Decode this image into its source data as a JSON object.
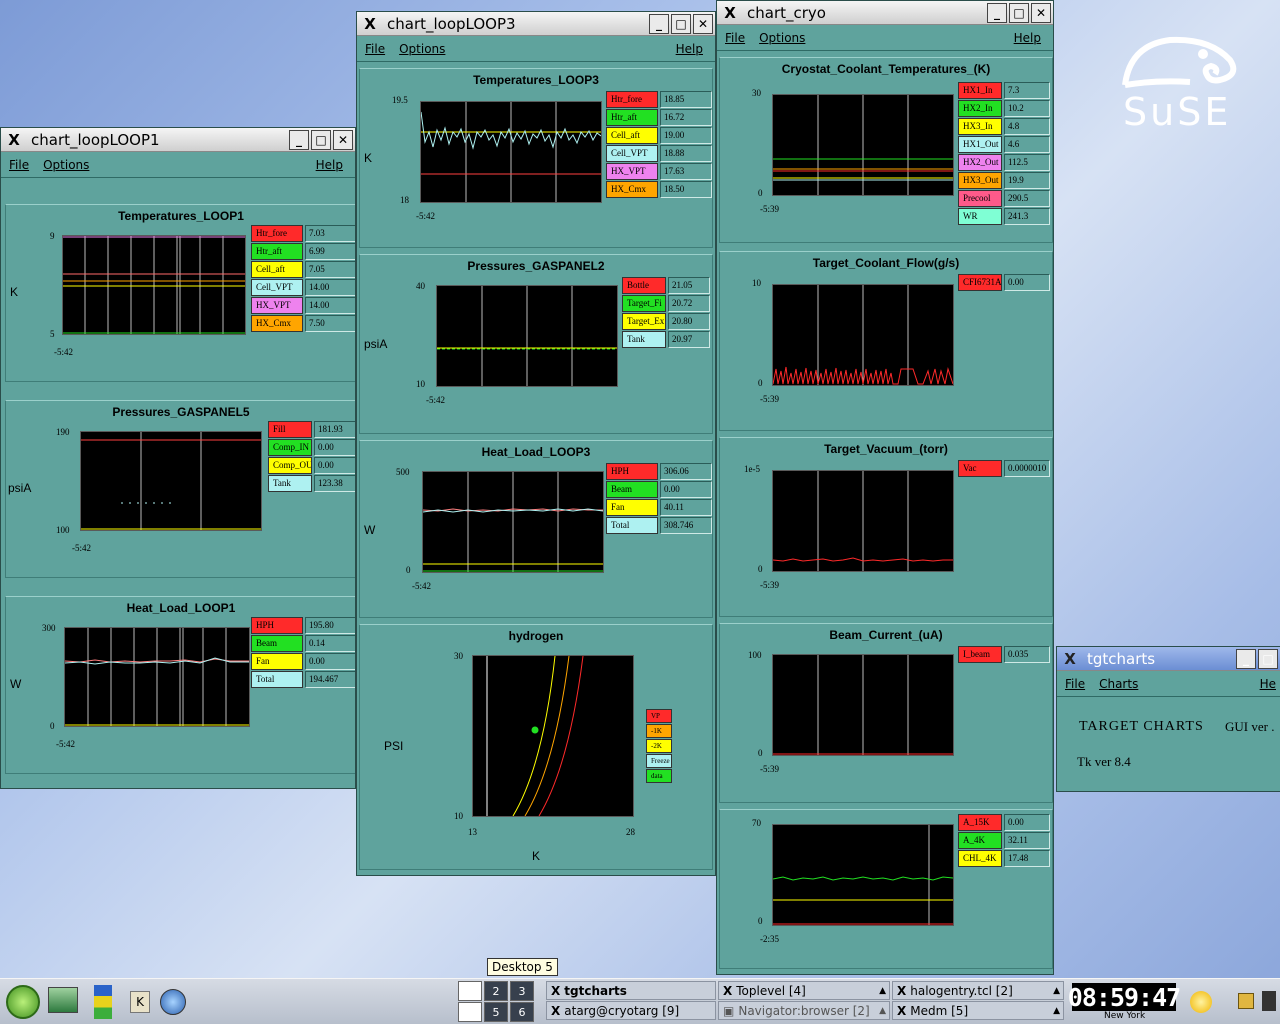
{
  "desktop": {
    "logo_text": "SuSE"
  },
  "loop1": {
    "title": "chart_loopLOOP1",
    "menu": {
      "file": "File",
      "options": "Options",
      "help": "Help"
    },
    "temps": {
      "title": "Temperatures_LOOP1",
      "unit": "K",
      "ymax": "9",
      "ymin": "5",
      "xmin": "-5:42",
      "legend": [
        {
          "name": "Htr_fore",
          "value": "7.03",
          "color": "#ff2a2a"
        },
        {
          "name": "Htr_aft",
          "value": "6.99",
          "color": "#22e022"
        },
        {
          "name": "Cell_aft",
          "value": "7.05",
          "color": "#ffff00"
        },
        {
          "name": "Cell_VPT",
          "value": "14.00",
          "color": "#aef1f1"
        },
        {
          "name": "HX_VPT",
          "value": "14.00",
          "color": "#ee82ee"
        },
        {
          "name": "HX_Cmx",
          "value": "7.50",
          "color": "#ffa500"
        }
      ]
    },
    "press": {
      "title": "Pressures_GASPANEL5",
      "unit": "psiA",
      "ymax": "190",
      "ymin": "100",
      "xmin": "-5:42",
      "legend": [
        {
          "name": "Fill",
          "value": "181.93",
          "color": "#ff2a2a"
        },
        {
          "name": "Comp_IN",
          "value": "0.00",
          "color": "#22e022"
        },
        {
          "name": "Comp_OUT",
          "value": "0.00",
          "color": "#ffff00"
        },
        {
          "name": "Tank",
          "value": "123.38",
          "color": "#aef1f1"
        }
      ]
    },
    "heat": {
      "title": "Heat_Load_LOOP1",
      "unit": "W",
      "ymax": "300",
      "ymin": "0",
      "xmin": "-5:42",
      "legend": [
        {
          "name": "HPH",
          "value": "195.80",
          "color": "#ff2a2a"
        },
        {
          "name": "Beam",
          "value": "0.14",
          "color": "#22e022"
        },
        {
          "name": "Fan",
          "value": "0.00",
          "color": "#ffff00"
        },
        {
          "name": "Total",
          "value": "194.467",
          "color": "#aef1f1"
        }
      ]
    }
  },
  "loop3": {
    "title": "chart_loopLOOP3",
    "menu": {
      "file": "File",
      "options": "Options",
      "help": "Help"
    },
    "temps": {
      "title": "Temperatures_LOOP3",
      "unit": "K",
      "ymax": "19.5",
      "ymin": "18",
      "xmin": "-5:42",
      "legend": [
        {
          "name": "Htr_fore",
          "value": "18.85",
          "color": "#ff2a2a"
        },
        {
          "name": "Htr_aft",
          "value": "16.72",
          "color": "#22e022"
        },
        {
          "name": "Cell_aft",
          "value": "19.00",
          "color": "#ffff00"
        },
        {
          "name": "Cell_VPT",
          "value": "18.88",
          "color": "#aef1f1"
        },
        {
          "name": "HX_VPT",
          "value": "17.63",
          "color": "#ee82ee"
        },
        {
          "name": "HX_Cmx",
          "value": "18.50",
          "color": "#ffa500"
        }
      ]
    },
    "press": {
      "title": "Pressures_GASPANEL2",
      "unit": "psiA",
      "ymax": "40",
      "ymin": "10",
      "xmin": "-5:42",
      "legend": [
        {
          "name": "Bottle",
          "value": "21.05",
          "color": "#ff2a2a"
        },
        {
          "name": "Target_Fi",
          "value": "20.72",
          "color": "#22e022"
        },
        {
          "name": "Target_Ex",
          "value": "20.80",
          "color": "#ffff00"
        },
        {
          "name": "Tank",
          "value": "20.97",
          "color": "#aef1f1"
        }
      ]
    },
    "heat": {
      "title": "Heat_Load_LOOP3",
      "unit": "W",
      "ymax": "500",
      "ymin": "0",
      "xmin": "-5:42",
      "legend": [
        {
          "name": "HPH",
          "value": "306.06",
          "color": "#ff2a2a"
        },
        {
          "name": "Beam",
          "value": "0.00",
          "color": "#22e022"
        },
        {
          "name": "Fan",
          "value": "40.11",
          "color": "#ffff00"
        },
        {
          "name": "Total",
          "value": "308.746",
          "color": "#aef1f1"
        }
      ]
    },
    "hydrogen": {
      "title": "hydrogen",
      "ylabel": "PSI",
      "xlabel": "K",
      "ymax": "30",
      "ymin": "10",
      "xmin": "13",
      "xmax": "28",
      "legend": [
        {
          "name": "VP",
          "color": "#ff2a2a"
        },
        {
          "name": "-1K",
          "color": "#ffa500"
        },
        {
          "name": "-2K",
          "color": "#ffff00"
        },
        {
          "name": "Freeze",
          "color": "#aef1f1"
        },
        {
          "name": "data",
          "color": "#22e022"
        }
      ]
    }
  },
  "cryo": {
    "title": "chart_cryo",
    "menu": {
      "file": "File",
      "options": "Options",
      "help": "Help"
    },
    "coolant": {
      "title": "Cryostat_Coolant_Temperatures_(K)",
      "ymax": "30",
      "ymin": "0",
      "xmin": "-5:39",
      "legend": [
        {
          "name": "HX1_In",
          "value": "7.3",
          "color": "#ff2a2a"
        },
        {
          "name": "HX2_In",
          "value": "10.2",
          "color": "#22e022"
        },
        {
          "name": "HX3_In",
          "value": "4.8",
          "color": "#ffff00"
        },
        {
          "name": "HX1_Out",
          "value": "4.6",
          "color": "#aef1f1"
        },
        {
          "name": "HX2_Out",
          "value": "112.5",
          "color": "#ee82ee"
        },
        {
          "name": "HX3_Out",
          "value": "19.9",
          "color": "#ffa500"
        },
        {
          "name": "Precool",
          "value": "290.5",
          "color": "#ff5a8a"
        },
        {
          "name": "WR",
          "value": "241.3",
          "color": "#7fffd4"
        }
      ]
    },
    "flow": {
      "title": "Target_Coolant_Flow(g/s)",
      "ymax": "10",
      "ymin": "0",
      "xmin": "-5:39",
      "legend": [
        {
          "name": "CFI6731A",
          "value": "0.00",
          "color": "#ff2a2a"
        }
      ]
    },
    "vacuum": {
      "title": "Target_Vacuum_(torr)",
      "ymax": "1e-5",
      "ymin": "0",
      "xmin": "-5:39",
      "legend": [
        {
          "name": "Vac",
          "value": "0.0000010",
          "color": "#ff2a2a"
        }
      ]
    },
    "beam": {
      "title": "Beam_Current_(uA)",
      "ymax": "100",
      "ymin": "0",
      "xmin": "-5:39",
      "legend": [
        {
          "name": "I_beam",
          "value": "0.035",
          "color": "#ff2a2a"
        }
      ]
    },
    "amps": {
      "ymax": "70",
      "ymin": "0",
      "xmin": "-2:35",
      "legend": [
        {
          "name": "A_15K",
          "value": "0.00",
          "color": "#ff2a2a"
        },
        {
          "name": "A_4K",
          "value": "32.11",
          "color": "#22e022"
        },
        {
          "name": "CHL_4K",
          "value": "17.48",
          "color": "#ffff00"
        }
      ]
    }
  },
  "tgt": {
    "title": "tgtcharts",
    "menu": {
      "file": "File",
      "charts": "Charts",
      "help": "He"
    },
    "heading": "TARGET CHARTS",
    "gui": "GUI ver .",
    "tk": "Tk ver 8.4"
  },
  "taskbar": {
    "tooltip": "Desktop 5",
    "desktops": [
      "2",
      "3",
      "5",
      "6"
    ],
    "tasks": {
      "t1": "tgtcharts",
      "t2": "atarg@cryotarg [9]",
      "t3": "Toplevel [4]",
      "t4": "Navigator:browser [2]",
      "t5": "halogentry.tcl [2]",
      "t6": "Medm [5]"
    },
    "clock": "08:59:47",
    "city": "New York"
  }
}
